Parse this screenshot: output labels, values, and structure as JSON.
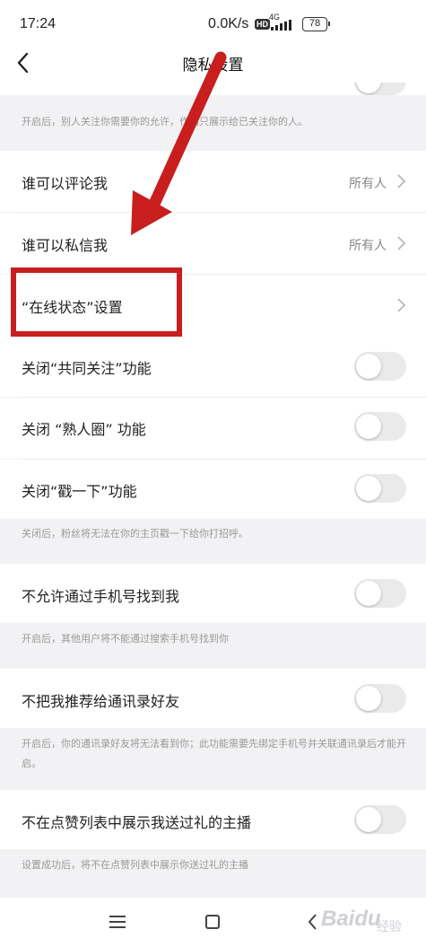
{
  "status_bar": {
    "time": "17:24",
    "network_speed": "0.0K/s",
    "hd_badge": "HD",
    "network_type": "4G",
    "battery": "78"
  },
  "header": {
    "title": "隐私设置"
  },
  "notes": {
    "top": "开启后，别人关注你需要你的允许，作品只展示给已关注你的人。",
    "poke": "关闭后，粉丝将无法在你的主页戳一下给你打招呼。",
    "phone": "开启后，其他用户将不能通过搜索手机号找到你",
    "contacts": "开启后，你的通讯录好友将无法看到你；此功能需要先绑定手机号并关联通讯录后才能开启。",
    "gift": "设置成功后，将不在点赞列表中展示你送过礼的主播"
  },
  "rows": {
    "comment": {
      "label": "谁可以评论我",
      "value": "所有人"
    },
    "message": {
      "label": "谁可以私信我",
      "value": "所有人"
    },
    "online_status": {
      "label": "“在线状态”设置"
    },
    "mutual_follow": {
      "label": "关闭“共同关注”功能"
    },
    "acquaintance": {
      "label": "关闭 “熟人圈” 功能"
    },
    "poke": {
      "label": "关闭“戳一下”功能"
    },
    "phone_search": {
      "label": "不允许通过手机号找到我"
    },
    "contacts_recommend": {
      "label": "不把我推荐给通讯录好友"
    },
    "gift_list": {
      "label": "不在点赞列表中展示我送过礼的主播"
    }
  },
  "toggles": {
    "top": false,
    "mutual_follow": false,
    "acquaintance": false,
    "poke": false,
    "phone_search": false,
    "contacts_recommend": false,
    "gift_list": false
  },
  "annotation": {
    "color": "#c81e1e"
  },
  "watermark": {
    "main": "Baidu",
    "sub": "经验"
  }
}
